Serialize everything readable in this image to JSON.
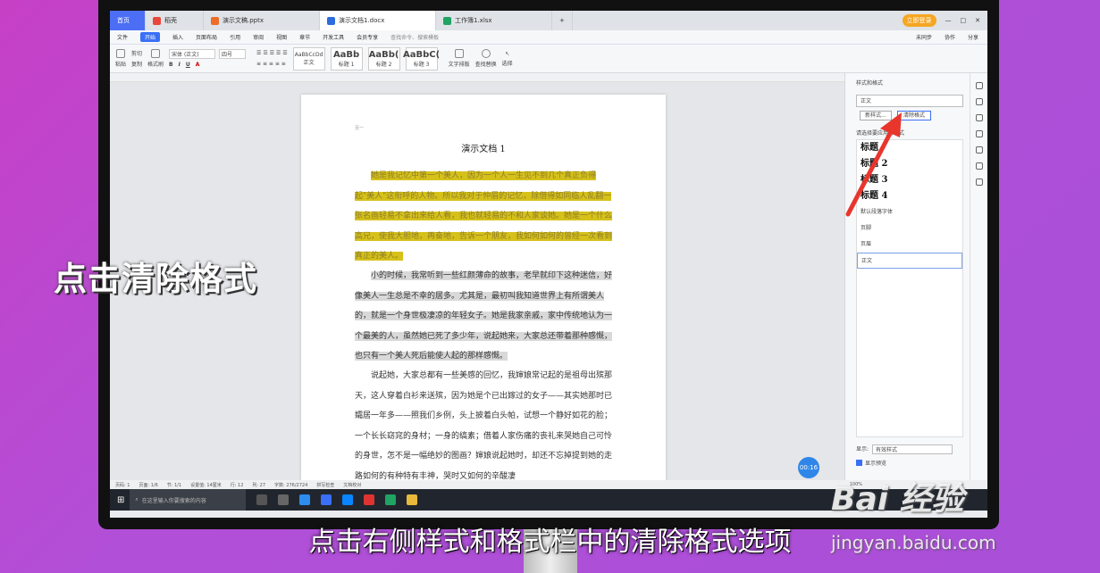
{
  "window": {
    "tabs": [
      {
        "label": "首页"
      },
      {
        "label": "稻壳"
      },
      {
        "label": "演示文稿.pptx"
      },
      {
        "label": "演示文档1.docx"
      },
      {
        "label": "工作簿1.xlsx"
      }
    ],
    "upgrade_label": "立即登录"
  },
  "menu": {
    "items": [
      "文件",
      "开始",
      "插入",
      "页面布局",
      "引用",
      "审阅",
      "视图",
      "章节",
      "开发工具",
      "会员专享"
    ],
    "search_placeholder": "查找命令、搜索模板",
    "right_items": [
      "未同步",
      "协作",
      "分享"
    ]
  },
  "ribbon": {
    "paste": "粘贴",
    "cut": "剪切",
    "copy": "复制",
    "format_painter": "格式刷",
    "font": "宋体 (正文)",
    "size": "四号",
    "styles": [
      {
        "preview": "AaBbCcDd",
        "label": "正文"
      },
      {
        "preview": "AaBb",
        "label": "标题 1"
      },
      {
        "preview": "AaBb(",
        "label": "标题 2"
      },
      {
        "preview": "AaBbC(",
        "label": "标题 3"
      }
    ],
    "text_layout": "文字排版",
    "find_replace": "查找替换",
    "select": "选择"
  },
  "document": {
    "header_mark": "页一",
    "title": "演示文档 1",
    "para1": "她是我记忆中第一个美人，因为一个人一生见不到几个真正负得起\"美人\"这衔呼的人物。所以我对于仲眉的记忆，除借得如同临人乱翻一张名画轻易不拿出来给人看，我也就轻易的不和人家谈她。她是一个什么高兄，使我大胆地，再奋地，告诉一个朋友，我如何如何的曾经一次看到真正的美人。",
    "para2": "小的时候，我常听到一些红颜薄命的故事，老早就印下这种迷信，好像美人一生总是不幸的居多。尤其是，最初叫我知道世界上有所谓美人的，就是一个身世极凄凉的年轻女子。她是我家亲戚，家中传统地认为一个最美的人，虽然她已死了多少年，说起她来，大家总还带着那种感慨，也只有一个美人死后能使人起的那样感慨。",
    "para3": "说起她，大家总都有一些美感的回忆，我婶娘常记起的是祖母出殡那天，这人穿着白衫来送殡，因为她是个已出嫁过的女子——其实她那时已孀居一年多——照我们乡例，头上披着白头帕，试想一个静好如花的脸；一个长长窈窕的身材；一身的缟素；借着人家伤痛的丧礼来哭她自己可怜的身世，怎不是一幅绝妙的图画？婶娘说起她时，却还不忘掉提到她的走路如何的有种特有丰神，哭时又如何的辛酸凄"
  },
  "style_panel": {
    "header": "样式和格式",
    "current": "正文",
    "new_style": "新样式...",
    "clear_format": "清除格式",
    "apply_label": "请选择要应用的格式",
    "styles": [
      {
        "label": "标题",
        "heading": true
      },
      {
        "label": "标题 2",
        "heading": true
      },
      {
        "label": "标题 3",
        "heading": true
      },
      {
        "label": "标题 4",
        "heading": true
      },
      {
        "label": "默认段落字体",
        "heading": false
      },
      {
        "label": "页脚",
        "heading": false
      },
      {
        "label": "页眉",
        "heading": false
      },
      {
        "label": "正文",
        "heading": false
      }
    ],
    "show_label": "显示:",
    "show_value": "有效样式",
    "preview_label": "显示预览"
  },
  "status": {
    "page": "页码: 1",
    "pages": "页面: 1/6",
    "section": "节: 1/1",
    "setting": "设置值: 14厘米",
    "row": "行: 12",
    "col": "列: 27",
    "words": "字数: 276/2724",
    "spell": "拼写检查",
    "proof": "文档校对",
    "zoom": "100%"
  },
  "taskbar": {
    "search": "在这里输入你要搜索的内容"
  },
  "timer": "00:16",
  "overlay": {
    "left_text": "点击清除格式",
    "caption": "点击右侧样式和格式栏中的清除格式选项",
    "watermark1": "Bai 经验",
    "watermark2": "jingyan.baidu.com"
  }
}
